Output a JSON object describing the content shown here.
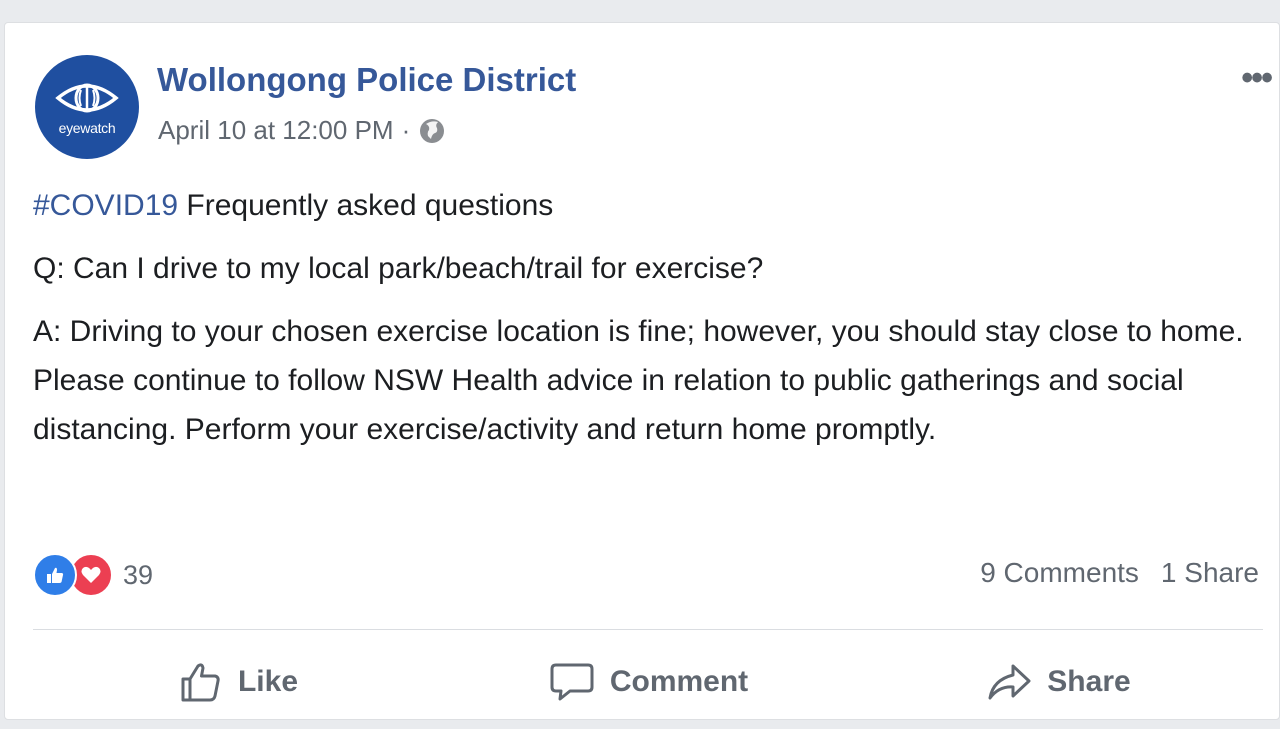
{
  "post": {
    "page_name": "Wollongong Police District",
    "avatar_text": "eyewatch",
    "timestamp": "April 10 at 12:00 PM",
    "separator": "·",
    "privacy_icon": "globe-icon",
    "more_icon": "more-options-icon",
    "hashtag": "#COVID19",
    "headline_rest": " Frequently asked questions",
    "question": "Q: Can I drive to my local park/beach/trail for exercise?",
    "answer": "A: Driving to your chosen exercise location is fine; however, you should stay close to home. Please continue to follow NSW Health advice in relation to public gatherings and social distancing. Perform your exercise/activity and return home promptly."
  },
  "reactions": {
    "icons": [
      "like-reaction-icon",
      "love-reaction-icon"
    ],
    "count": "39",
    "comments": "9 Comments",
    "shares": "1 Share"
  },
  "actions": {
    "like_label": "Like",
    "comment_label": "Comment",
    "share_label": "Share"
  },
  "colors": {
    "link_blue": "#365899",
    "avatar_blue": "#1f4fa0",
    "like_blue": "#2f7ee8",
    "love_red": "#ec3f52",
    "secondary_text": "#606770"
  }
}
